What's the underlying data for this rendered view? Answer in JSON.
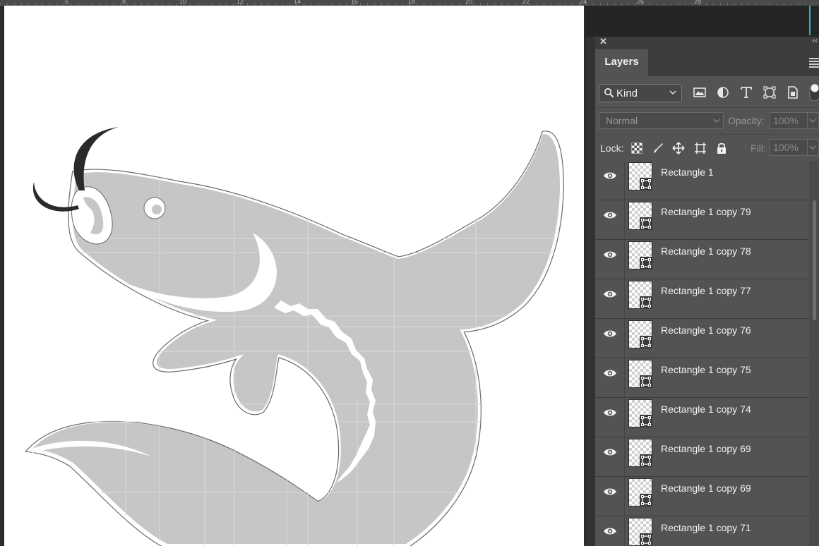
{
  "ruler": {
    "numbers": [
      "6",
      "8",
      "10",
      "12",
      "14",
      "16",
      "18",
      "20",
      "22",
      "24",
      "26",
      "28"
    ]
  },
  "layers_panel": {
    "tab_label": "Layers",
    "close_glyph": "✕",
    "collapse_glyph": "‹‹",
    "filter": {
      "kind_label": "Kind",
      "icons": [
        "image-filter-icon",
        "adjustment-filter-icon",
        "type-filter-icon",
        "shape-filter-icon",
        "smart-object-filter-icon"
      ]
    },
    "blend_mode": "Normal",
    "opacity_label": "Opacity:",
    "opacity_value": "100%",
    "lock_label": "Lock:",
    "fill_label": "Fill:",
    "fill_value": "100%",
    "layers": [
      {
        "name": "Rectangle 1",
        "visible": true,
        "selected": false
      },
      {
        "name": "Rectangle 1 copy 79",
        "visible": true,
        "selected": false
      },
      {
        "name": "Rectangle 1 copy 78",
        "visible": true,
        "selected": false
      },
      {
        "name": "Rectangle 1 copy 77",
        "visible": true,
        "selected": false
      },
      {
        "name": "Rectangle 1 copy 76",
        "visible": true,
        "selected": false
      },
      {
        "name": "Rectangle 1 copy 75",
        "visible": true,
        "selected": false
      },
      {
        "name": "Rectangle 1 copy 74",
        "visible": true,
        "selected": false
      },
      {
        "name": "Rectangle 1 copy 69",
        "visible": true,
        "selected": false
      },
      {
        "name": "Rectangle 1 copy 69",
        "visible": true,
        "selected": false
      },
      {
        "name": "Rectangle 1 copy 71",
        "visible": true,
        "selected": false
      }
    ]
  },
  "colors": {
    "fish_fill": "#c6c6c6",
    "fish_outline": "#5a5a5a",
    "panel_bg": "#535353",
    "guide": "#2ab6c8"
  }
}
